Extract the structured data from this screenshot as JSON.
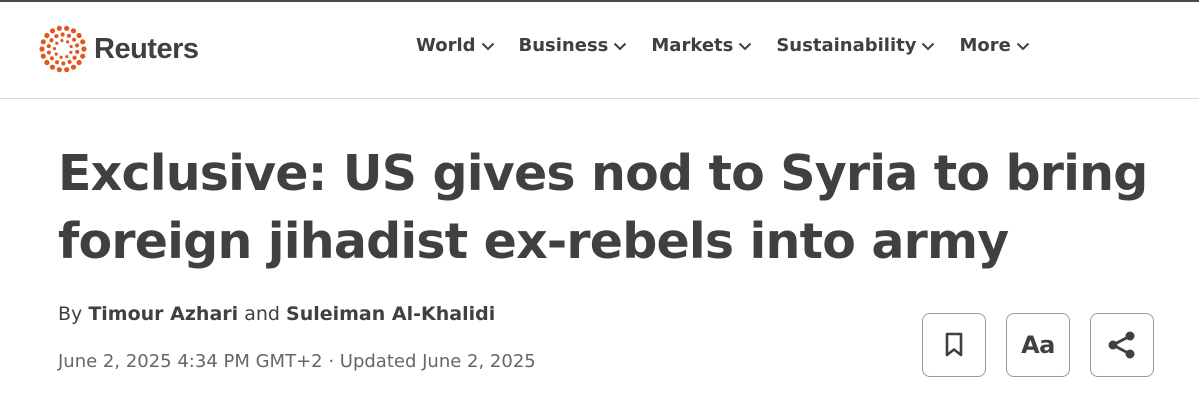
{
  "brand": {
    "name": "Reuters",
    "logo_icon": "reuters-dotted-circle-icon",
    "accent_color": "#e2571e"
  },
  "nav": {
    "items": [
      {
        "label": "World",
        "icon": "chevron-down-icon"
      },
      {
        "label": "Business",
        "icon": "chevron-down-icon"
      },
      {
        "label": "Markets",
        "icon": "chevron-down-icon"
      },
      {
        "label": "Sustainability",
        "icon": "chevron-down-icon"
      },
      {
        "label": "More",
        "icon": "chevron-down-icon"
      }
    ]
  },
  "article": {
    "headline": "Exclusive: US gives nod to Syria to bring foreign jihadist ex-rebels into army",
    "byline": {
      "prefix": "By",
      "authors": [
        "Timour Azhari",
        "Suleiman Al-Khalidi"
      ],
      "conjunction": "and"
    },
    "dateline": "June 2, 2025 4:34 PM GMT+2 · Updated June 2, 2025"
  },
  "actions": {
    "bookmark_icon": "bookmark-icon",
    "text_size_label": "Aa",
    "share_icon": "share-icon"
  }
}
